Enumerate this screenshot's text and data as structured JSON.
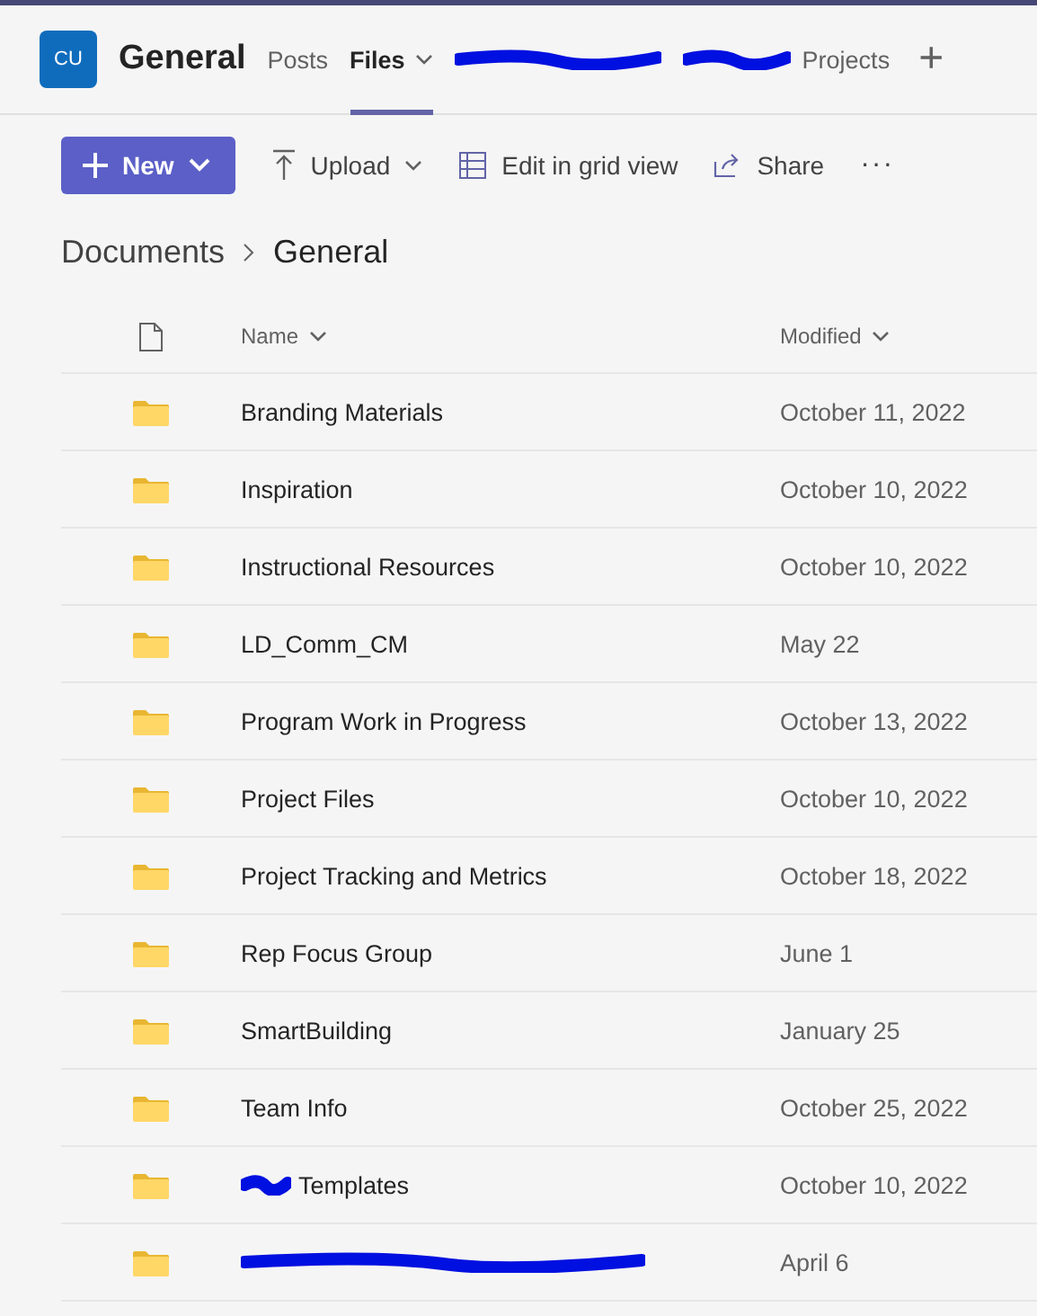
{
  "header": {
    "avatar": "CU",
    "title": "General",
    "tabs": [
      {
        "label": "Posts",
        "selected": false,
        "dropdown": false,
        "redacted": false
      },
      {
        "label": "Files",
        "selected": true,
        "dropdown": true,
        "redacted": false
      },
      {
        "selected": false,
        "dropdown": false,
        "redacted": true
      },
      {
        "label": "Projects",
        "selected": false,
        "dropdown": false,
        "redacted": true
      }
    ],
    "add": "+"
  },
  "toolbar": {
    "new": "New",
    "items": [
      {
        "kind": "upload",
        "label": "Upload"
      },
      {
        "kind": "grid",
        "label": "Edit in grid view"
      },
      {
        "kind": "share",
        "label": "Share"
      }
    ],
    "more": "···"
  },
  "breadcrumb": [
    "Documents",
    "General"
  ],
  "columns": {
    "name": "Name",
    "modified": "Modified"
  },
  "rows": [
    {
      "name": "Branding Materials",
      "modified": "October 11, 2022",
      "redacted": false
    },
    {
      "name": "Inspiration",
      "modified": "October 10, 2022",
      "redacted": false
    },
    {
      "name": "Instructional Resources",
      "modified": "October 10, 2022",
      "redacted": false
    },
    {
      "name": "LD_Comm_CM",
      "modified": "May 22",
      "redacted": false
    },
    {
      "name": "Program Work in Progress",
      "modified": "October 13, 2022",
      "redacted": false
    },
    {
      "name": "Project Files",
      "modified": "October 10, 2022",
      "redacted": false
    },
    {
      "name": "Project Tracking and Metrics",
      "modified": "October 18, 2022",
      "redacted": false
    },
    {
      "name": "Rep Focus Group",
      "modified": "June 1",
      "redacted": false
    },
    {
      "name": "SmartBuilding",
      "modified": "January 25",
      "redacted": false
    },
    {
      "name": "Team Info",
      "modified": "October 25, 2022",
      "redacted": false
    },
    {
      "name": "Templates",
      "modified": "October 10, 2022",
      "redacted": true
    },
    {
      "modified": "April 6",
      "redacted": true
    }
  ]
}
